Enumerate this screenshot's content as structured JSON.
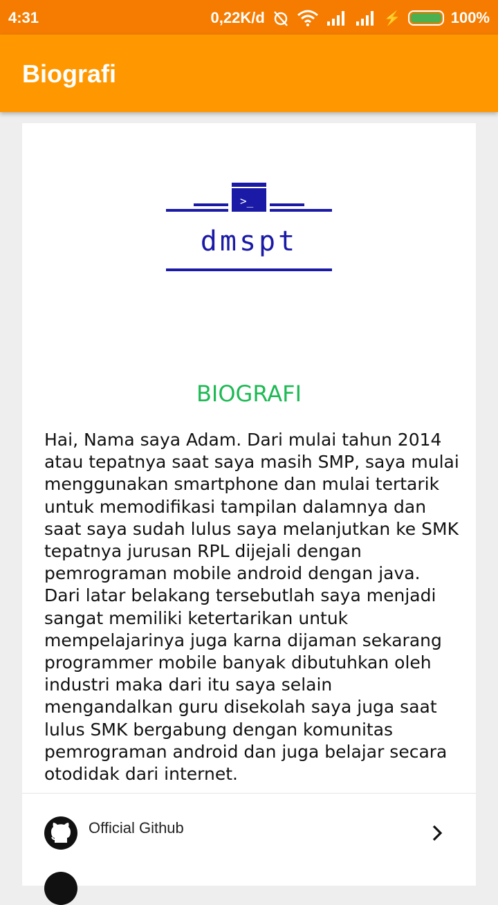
{
  "status_bar": {
    "time": "4:31",
    "network_speed": "0,22K/d",
    "battery_percent": "100%",
    "icons": [
      "alarm-off-icon",
      "wifi-icon",
      "signal-icon",
      "signal-icon",
      "charging-icon",
      "battery-icon"
    ]
  },
  "app_bar": {
    "title": "Biografi"
  },
  "logo": {
    "text": "dmspt",
    "glyph": ">_"
  },
  "content": {
    "heading": "BIOGRAFI",
    "bio": "Hai, Nama saya Adam. Dari mulai tahun 2014 atau tepatnya saat saya masih SMP, saya mulai menggunakan smartphone dan mulai tertarik untuk memodifikasi tampilan dalamnya dan saat saya sudah lulus saya melanjutkan ke SMK tepatnya jurusan RPL dijejali dengan pemrograman mobile android dengan java. Dari latar belakang tersebutlah saya menjadi sangat memiliki ketertarikan untuk mempelajarinya juga karna dijaman sekarang programmer mobile banyak dibutuhkan oleh industri maka dari itu saya selain mengandalkan guru disekolah saya juga saat lulus SMK bergabung dengan komunitas pemrograman android dan juga belajar secara otodidak dari internet."
  },
  "links": [
    {
      "label": "Official Github",
      "icon": "github-icon"
    }
  ],
  "colors": {
    "status_bar": "#f57c00",
    "app_bar": "#ff9800",
    "heading": "#1db954",
    "logo": "#1a1aa6",
    "battery": "#4caf50"
  }
}
